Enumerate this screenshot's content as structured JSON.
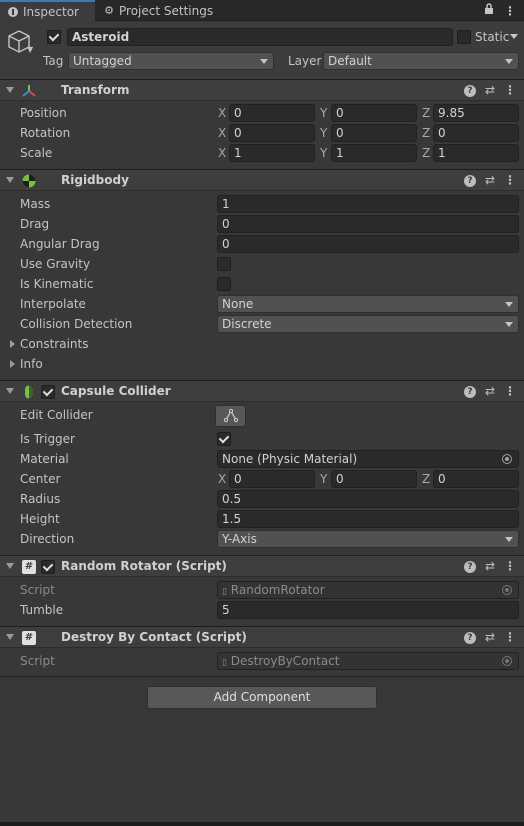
{
  "tabs": [
    {
      "label": "Inspector",
      "icon": "info-icon",
      "active": true
    },
    {
      "label": "Project Settings",
      "icon": "gear-icon",
      "active": false
    }
  ],
  "header": {
    "object_name": "Asteroid",
    "static_label": "Static",
    "tag_label": "Tag",
    "tag_value": "Untagged",
    "layer_label": "Layer",
    "layer_value": "Default"
  },
  "transform": {
    "title": "Transform",
    "rows": [
      {
        "label": "Position",
        "x": "0",
        "y": "0",
        "z": "9.85"
      },
      {
        "label": "Rotation",
        "x": "0",
        "y": "0",
        "z": "0"
      },
      {
        "label": "Scale",
        "x": "1",
        "y": "1",
        "z": "1"
      }
    ],
    "axis": {
      "x": "X",
      "y": "Y",
      "z": "Z"
    }
  },
  "rigidbody": {
    "title": "Rigidbody",
    "mass_label": "Mass",
    "mass": "1",
    "drag_label": "Drag",
    "drag": "0",
    "angular_drag_label": "Angular Drag",
    "angular_drag": "0",
    "use_gravity_label": "Use Gravity",
    "is_kinematic_label": "Is Kinematic",
    "interpolate_label": "Interpolate",
    "interpolate": "None",
    "collision_label": "Collision Detection",
    "collision": "Discrete",
    "constraints_label": "Constraints",
    "info_label": "Info"
  },
  "capsule": {
    "title": "Capsule Collider",
    "edit_label": "Edit Collider",
    "trigger_label": "Is Trigger",
    "material_label": "Material",
    "material": "None (Physic Material)",
    "center_label": "Center",
    "cx": "0",
    "cy": "0",
    "cz": "0",
    "radius_label": "Radius",
    "radius": "0.5",
    "height_label": "Height",
    "height": "1.5",
    "direction_label": "Direction",
    "direction": "Y-Axis"
  },
  "random_rotator": {
    "title": "Random Rotator (Script)",
    "script_label": "Script",
    "script": "RandomRotator",
    "tumble_label": "Tumble",
    "tumble": "5"
  },
  "destroy_by_contact": {
    "title": "Destroy By Contact (Script)",
    "script_label": "Script",
    "script": "DestroyByContact"
  },
  "add_component": "Add Component",
  "colors": {
    "accent": "#3a79bb",
    "background": "#383838",
    "field": "#2a2a2a"
  }
}
